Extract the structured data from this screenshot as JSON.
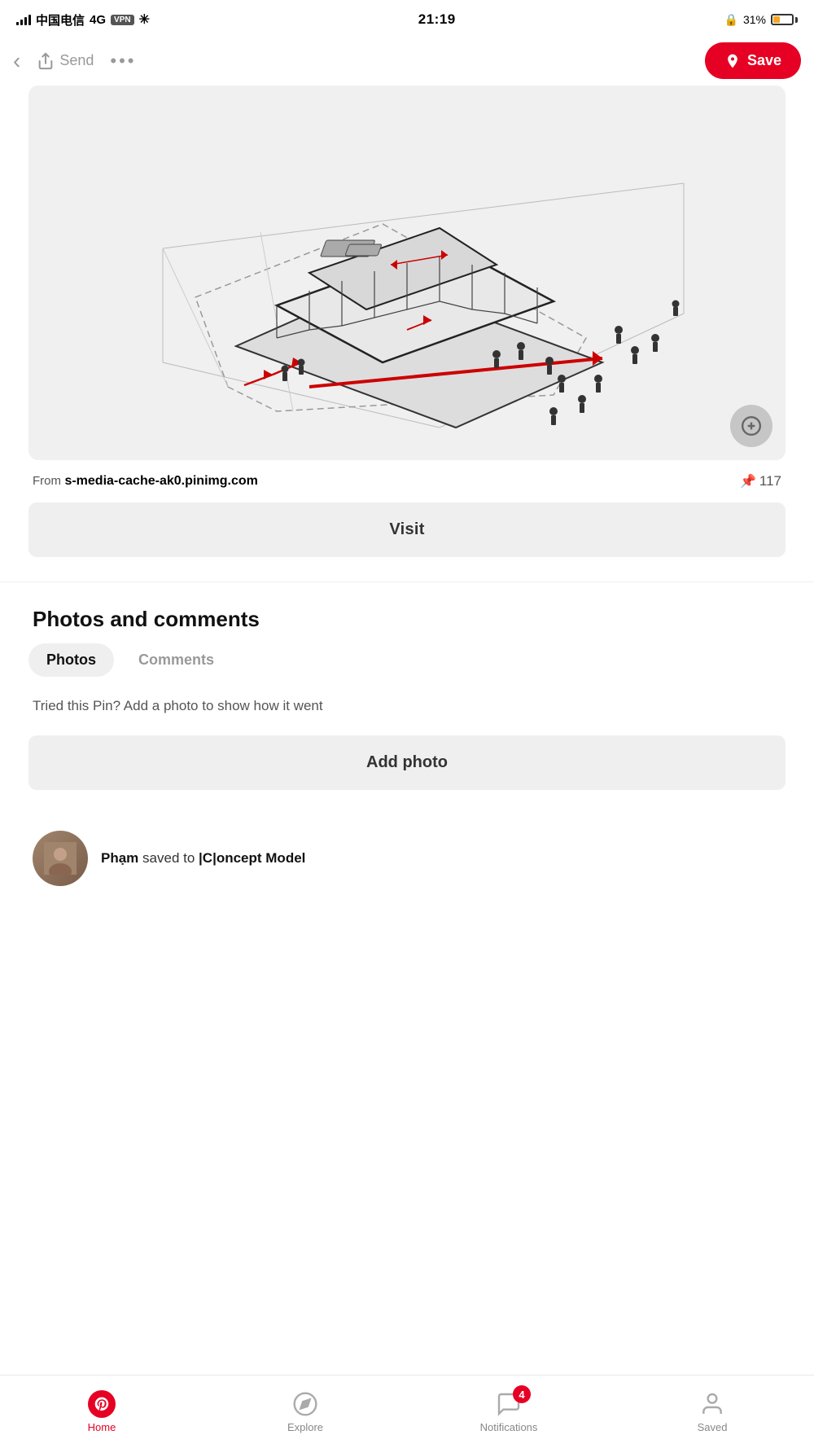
{
  "status_bar": {
    "carrier": "中国电信",
    "network": "4G",
    "vpn": "VPN",
    "time": "21:19",
    "battery_percent": "31%",
    "privacy_icon": "🔒"
  },
  "nav": {
    "back_label": "‹",
    "send_label": "Send",
    "more_label": "•••",
    "save_label": "Save"
  },
  "pin": {
    "source_prefix": "From",
    "source_domain": "s-media-cache-ak0.pinimg.com",
    "save_count": "117",
    "visit_button_label": "Visit"
  },
  "photos_comments": {
    "section_title": "Photos and comments",
    "tab_photos": "Photos",
    "tab_comments": "Comments",
    "try_text": "Tried this Pin? Add a photo to show how it went",
    "add_photo_label": "Add photo"
  },
  "saved_by": {
    "user_name": "Phạm",
    "action": "saved to",
    "board_name": "|C|oncept Model"
  },
  "bottom_tabs": {
    "home_label": "Home",
    "explore_label": "Explore",
    "notifications_label": "Notifications",
    "saved_label": "Saved",
    "notification_count": "4"
  }
}
